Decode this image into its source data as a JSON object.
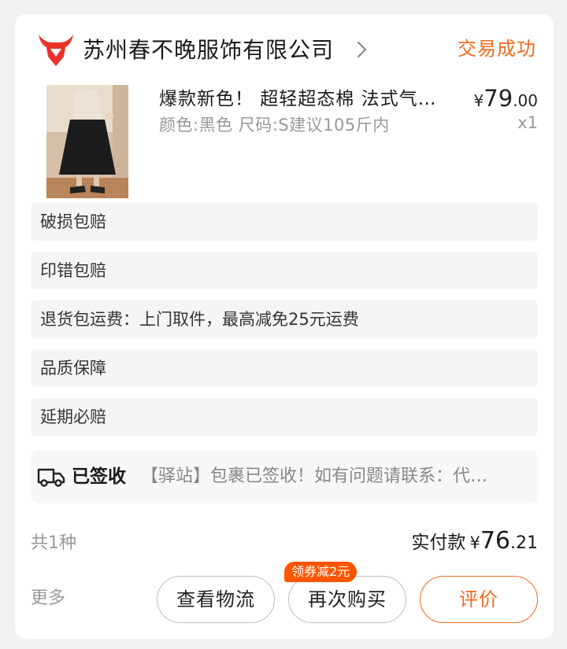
{
  "shop": {
    "name": "苏州春不晚服饰有限公司",
    "status": "交易成功",
    "logo_color": "#e8322a"
  },
  "product": {
    "title": "爆款新色！ 超轻超态棉 法式气…",
    "spec": "颜色:黑色 尺码:S建议105斤内",
    "price_currency": "¥",
    "price_int": "79",
    "price_dec": ".00",
    "quantity": "x1"
  },
  "services": [
    "破损包赔",
    "印错包赔",
    "退货包运费：上门取件，最高减免25元运费",
    "品质保障",
    "延期必赔"
  ],
  "logistics": {
    "icon": "truck-icon",
    "status": "已签收",
    "detail": "【驿站】包裹已签收！如有问题请联系：代…"
  },
  "summary": {
    "count": "共1种",
    "paid_label": "实付款",
    "paid_currency": "¥",
    "paid_int": "76",
    "paid_dec": ".21"
  },
  "actions": {
    "more": "更多",
    "view_logistics": "查看物流",
    "buy_again": "再次购买",
    "coupon": "领券减2元",
    "review": "评价"
  },
  "colors": {
    "accent": "#f26a1f",
    "coupon_bg": "#ff5500"
  }
}
